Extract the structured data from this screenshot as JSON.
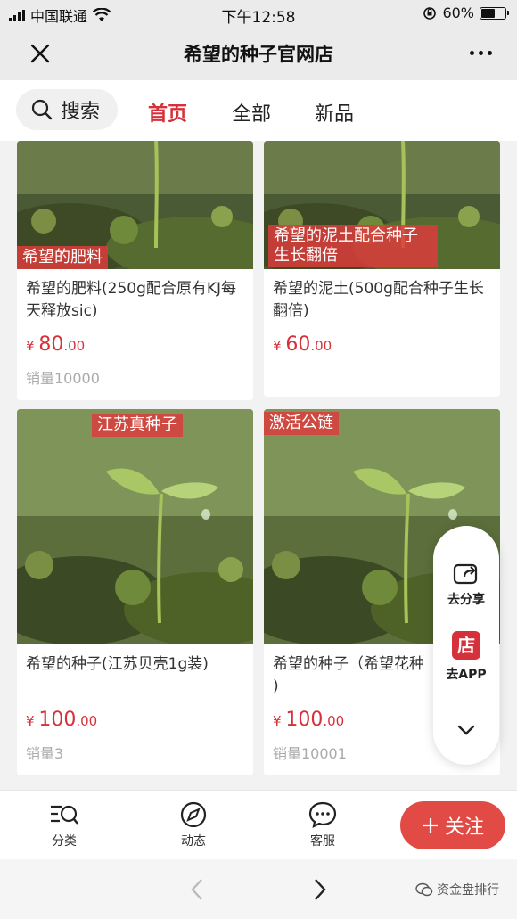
{
  "status_bar": {
    "carrier": "中国联通",
    "time": "下午12:58",
    "battery_percent": "60%",
    "battery_level": 0.6
  },
  "title_bar": {
    "title": "希望的种子官网店"
  },
  "nav": {
    "search_label": "搜索",
    "tabs": [
      {
        "label": "首页",
        "active": true
      },
      {
        "label": "全部",
        "active": false
      },
      {
        "label": "新品",
        "active": false
      }
    ]
  },
  "products": [
    {
      "tag": "希望的肥料",
      "name": "希望的肥料(250g配合原有KJ每天释放sic)",
      "currency": "¥",
      "price_int": "80",
      "price_dec": ".00",
      "sales": "销量10000"
    },
    {
      "tag": "希望的泥土配合种子生长翻倍",
      "name": "希望的泥土(500g配合种子生长翻倍)",
      "currency": "¥",
      "price_int": "60",
      "price_dec": ".00",
      "sales": ""
    },
    {
      "tag": "江苏真种子",
      "name": "希望的种子(江苏贝壳1g装)",
      "currency": "¥",
      "price_int": "100",
      "price_dec": ".00",
      "sales": "销量3"
    },
    {
      "tag": "激活公链",
      "name": "希望的种子（希望花种子）",
      "currency": "¥",
      "price_int": "100",
      "price_dec": ".00",
      "sales": "销量10001"
    }
  ],
  "product_name_visible": {
    "p4": "希望的种子（希望花种\n)"
  },
  "floating_panel": {
    "share_label": "去分享",
    "app_label": "去APP",
    "app_icon_text": "店"
  },
  "bottom_bar": {
    "category_label": "分类",
    "feed_label": "动态",
    "service_label": "客服",
    "follow_label": "关注"
  },
  "watermark": "资金盘排行",
  "colors": {
    "accent": "#d6313b",
    "follow_button": "#e14a45"
  }
}
